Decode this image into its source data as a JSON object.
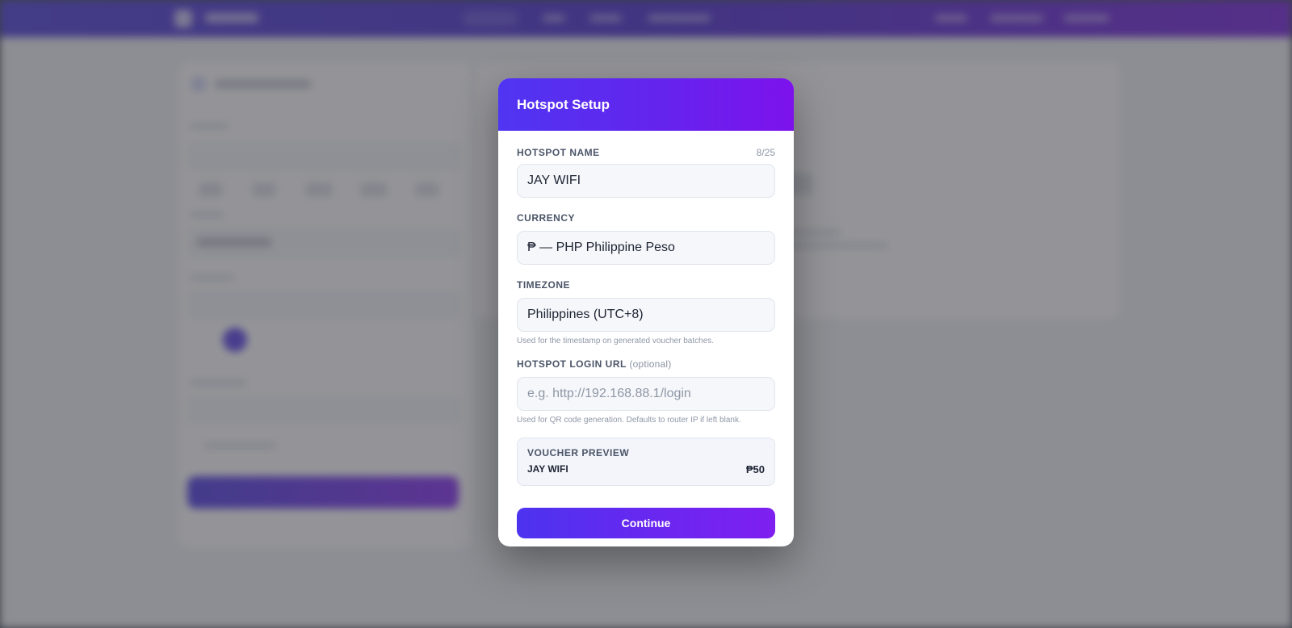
{
  "modal": {
    "title": "Hotspot Setup",
    "hotspot_name": {
      "label": "HOTSPOT NAME",
      "counter": "8/25",
      "value": "JAY WIFI"
    },
    "currency": {
      "label": "CURRENCY",
      "value": "₱ — PHP Philippine Peso"
    },
    "timezone": {
      "label": "TIMEZONE",
      "value": "Philippines (UTC+8)",
      "help": "Used for the timestamp on generated voucher batches."
    },
    "login_url": {
      "label": "HOTSPOT LOGIN URL",
      "optional": "(optional)",
      "placeholder": "e.g. http://192.168.88.1/login",
      "value": "",
      "help": "Used for QR code generation. Defaults to router IP if left blank."
    },
    "preview": {
      "label": "VOUCHER PREVIEW",
      "name": "JAY WIFI",
      "price": "₱50"
    },
    "continue_label": "Continue"
  },
  "colors": {
    "accent_start": "#4c33ef",
    "accent_end": "#7e1ff0",
    "overlay": "rgba(70,70,78,0.58)"
  }
}
